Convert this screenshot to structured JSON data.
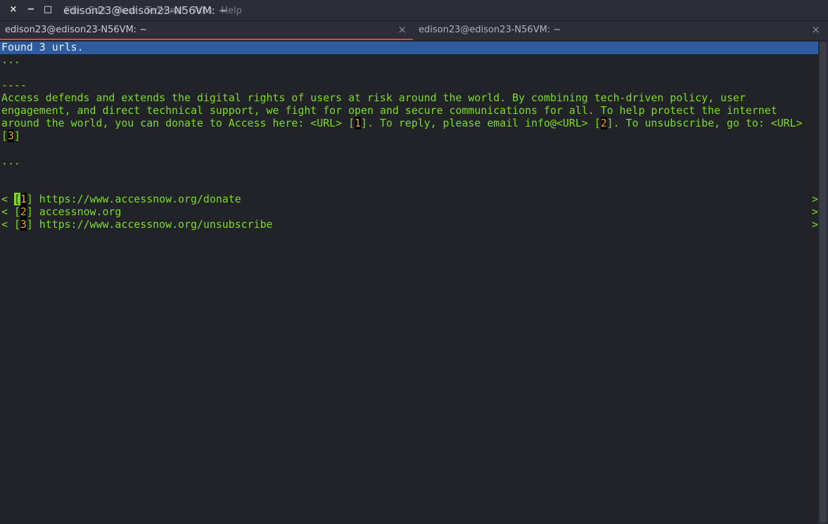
{
  "window": {
    "title": "edison23@edison23-N56VM: ~",
    "close_icon": "×",
    "minimize_icon": "−",
    "maximize_icon": "□",
    "menu_items": [
      "File",
      "Edit",
      "View",
      "Terminal",
      "Tabs",
      "Help"
    ]
  },
  "tabs": [
    {
      "label": "edison23@edison23-N56VM: ~",
      "close": "×",
      "active": true
    },
    {
      "label": "edison23@edison23-N56VM: ~",
      "close": "×",
      "active": false
    }
  ],
  "terminal": {
    "status": "Found 3 urls.",
    "ellipsis1": "...",
    "separator": "----",
    "body": [
      "Access defends and extends the digital rights of users at risk around the world. By combining tech-driven policy, user",
      "engagement, and direct technical support, we fight for open and secure communications for all. To help protect the internet"
    ],
    "line3_a": "around the world, you can donate to Access here: <URL> [",
    "line3_n1": "1",
    "line3_b": "]. To reply, please email info@<URL> [",
    "line3_n2": "2",
    "line3_c": "]. To unsubscribe, go to: <URL>",
    "line4_a": "[",
    "line4_n3": "3",
    "line4_b": "]",
    "ellipsis2": "...",
    "urls": [
      {
        "prefix": "< ",
        "open": "[",
        "num": "1",
        "close": "]",
        "url": " https://www.accessnow.org/donate",
        "arrow": ">"
      },
      {
        "prefix": "< ",
        "open": "[",
        "num": "2",
        "close": "]",
        "url": " accessnow.org",
        "arrow": ">"
      },
      {
        "prefix": "< ",
        "open": "[",
        "num": "3",
        "close": "]",
        "url": " https://www.accessnow.org/unsubscribe",
        "arrow": ">"
      }
    ]
  },
  "colors": {
    "text": "#7ddc1f",
    "highlight": "#2e5b9e",
    "number": "#f5a623",
    "background": "#212329"
  }
}
